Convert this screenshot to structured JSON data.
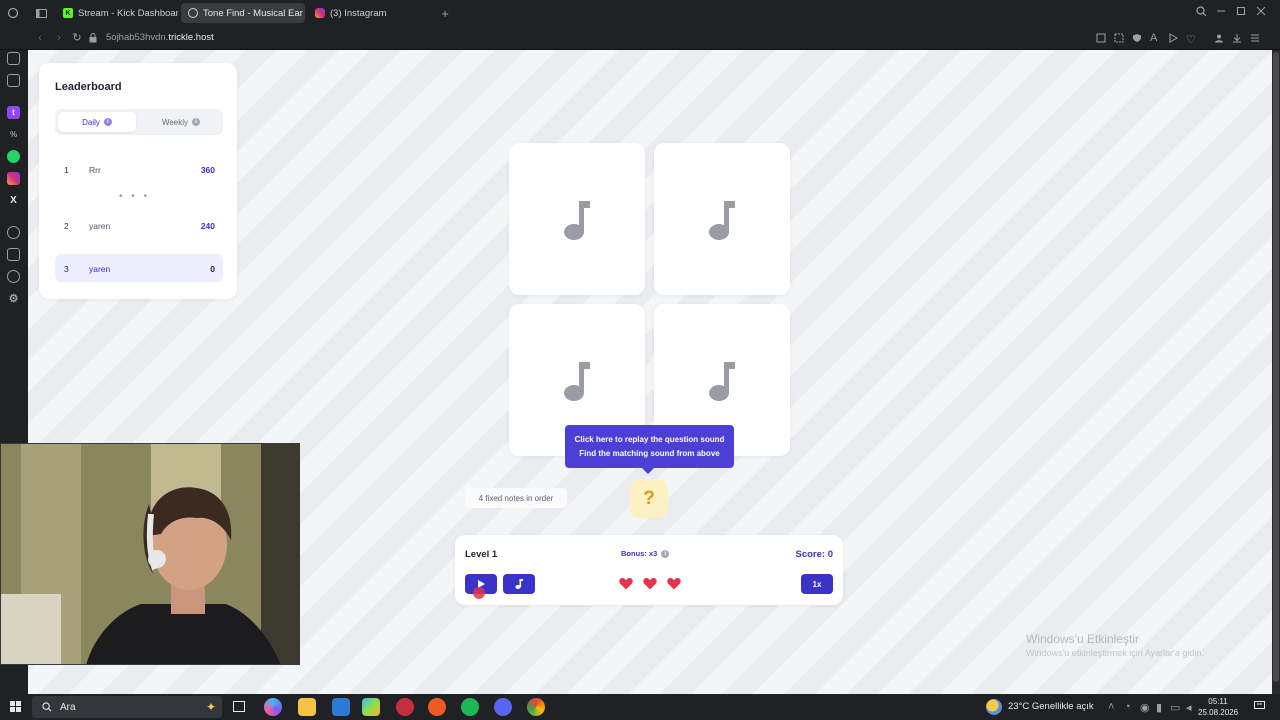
{
  "browser": {
    "tabs": [
      {
        "label": "Stream - Kick Dashboard",
        "active": false
      },
      {
        "label": "Tone Find - Musical Ear Tr",
        "active": true
      },
      {
        "label": "(3) Instagram",
        "active": false
      }
    ],
    "url_prefix": "5ojhab53hvdn.",
    "url_domain": "trickle.host"
  },
  "leaderboard": {
    "title": "Leaderboard",
    "tabs": [
      {
        "label": "Daily",
        "active": true
      },
      {
        "label": "Weekly",
        "active": false
      }
    ],
    "rows": [
      {
        "rank": "1",
        "name": "Rrr",
        "score": "360"
      },
      {
        "rank": "2",
        "name": "yaren",
        "score": "240"
      },
      {
        "rank": "3",
        "name": "yaren",
        "score": "0",
        "current_user": true
      }
    ],
    "ellipsis": "• • •"
  },
  "game": {
    "card_icon": "music-note-icon",
    "tooltip": {
      "line1": "Click here to replay the question sound",
      "line2": "Find the matching sound from above"
    },
    "hint": "4 fixed notes in order",
    "question_mark": "?"
  },
  "panel": {
    "level": "Level 1",
    "bonus": "Bonus: x3",
    "score": "Score: 0",
    "lives": 3,
    "speed": "1x"
  },
  "watermark": {
    "title": "Windows'u Etkinleştir",
    "subtitle": "Windows'u etkinleştirmek için Ayarlar'a gidin."
  },
  "taskbar": {
    "search_placeholder": "Ara",
    "weather": "23°C  Genellikle açık",
    "time": "05:11",
    "date": "25.08.2026"
  },
  "colors": {
    "accent": "#3a33c8",
    "heart": "#e5334b",
    "question_bg": "#fdf0c2"
  }
}
